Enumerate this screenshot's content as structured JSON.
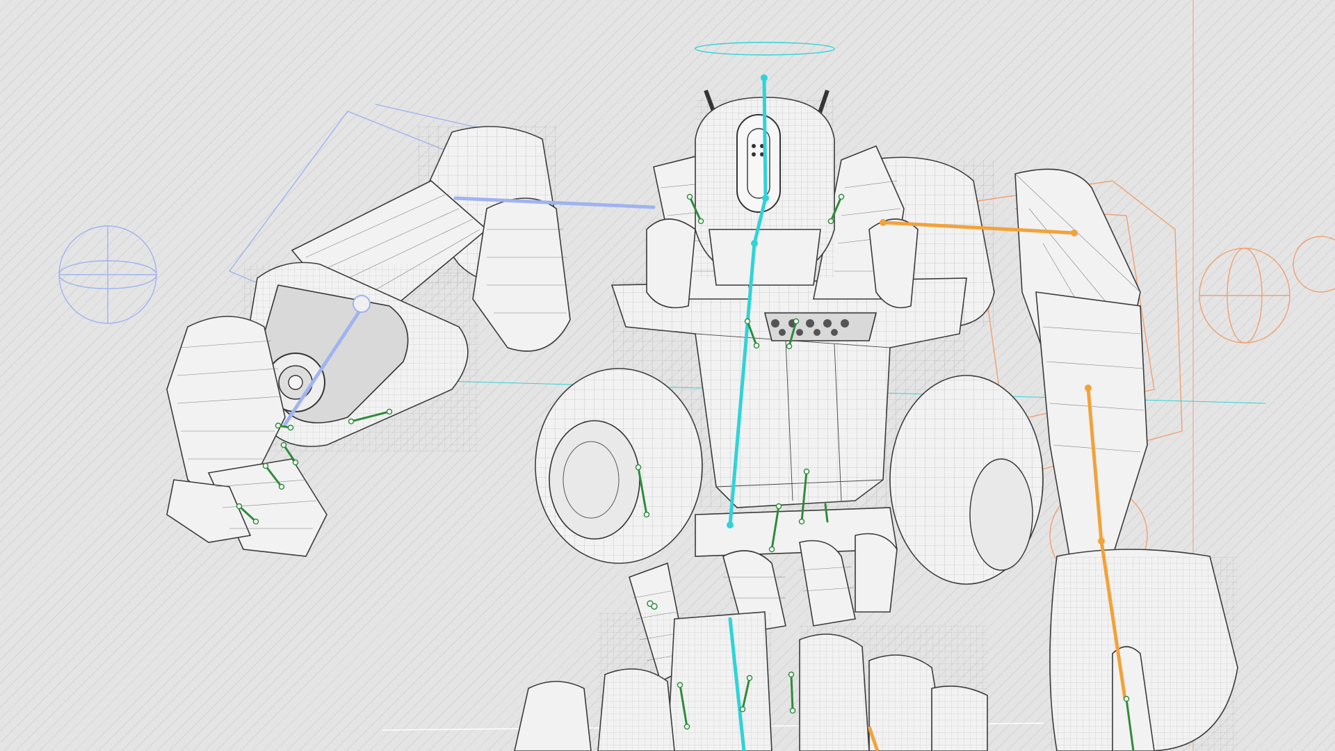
{
  "scene": {
    "subject": "robot-wireframe-rig",
    "colors": {
      "background": "#e4e4e4",
      "mesh_fill": "#f2f2f2",
      "mesh_line": "#3a3a3a",
      "spine_bone": "#2fd3d8",
      "left_arm_rig": "#9fb3f0",
      "right_arm_rig": "#f2a23a",
      "ik_helper": "#f0a070",
      "joint_bone": "#2e8b3a"
    },
    "rig_groups": [
      "spine-chain",
      "left-arm-chain",
      "right-arm-chain",
      "finger-bones",
      "pelvis-bones",
      "ik-controllers"
    ]
  }
}
